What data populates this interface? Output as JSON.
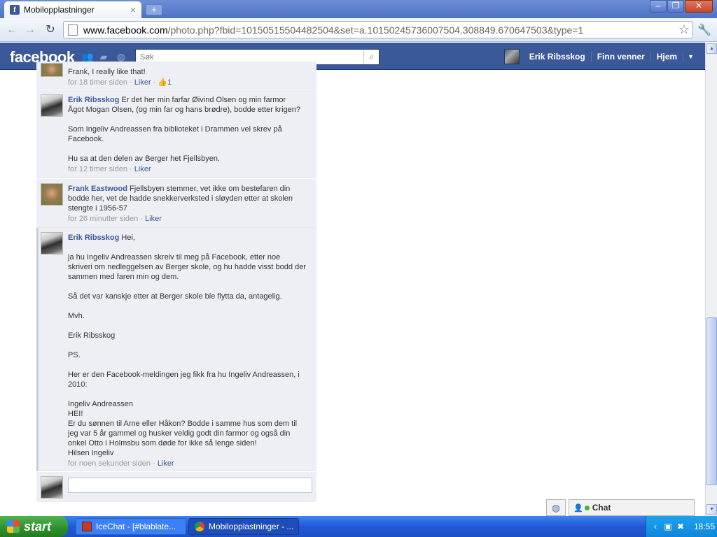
{
  "browser": {
    "tab_title": "Mobilopplastninger",
    "tab_close": "×",
    "new_tab": "+",
    "url_host": "www.facebook.com",
    "url_path": "/photo.php?fbid=10150515504482504&set=a.10150245736007504.308849.670647503&type=1"
  },
  "facebook": {
    "logo": "facebook",
    "search_placeholder": "Søk",
    "user_name": "Erik Ribsskog",
    "find_friends": "Finn venner",
    "home": "Hjem"
  },
  "comments": [
    {
      "author": "",
      "text": "Frank, I really like that!",
      "time": "for 18 timer siden",
      "like": "Liker",
      "like_count": "1"
    },
    {
      "author": "Erik Ribsskog",
      "text_first": "Er det her min farfar Øivind Olsen og min farmor",
      "text_rest": "Ågot Mogan Olsen, (og min far og hans brødre), bodde etter krigen?\n\nSom Ingeliv Andreassen fra biblioteket i Drammen vel skrev på Facebook.\n\nHu sa at den delen av Berger het Fjellsbyen.",
      "time": "for 12 timer siden",
      "like": "Liker"
    },
    {
      "author": "Frank Eastwood",
      "text_first": "Fjellsbyen stemmer, vet ikke om bestefaren din",
      "text_rest": "bodde her, vet de hadde snekkerverksted i sløyden etter at skolen stengte i 1956-57",
      "time": "for 26 minutter siden",
      "like": "Liker"
    },
    {
      "author": "Erik Ribsskog",
      "text_first": "Hei,",
      "text_rest": "\nja hu Ingeliv Andreassen skreiv til meg på Facebook, etter noe skriveri om nedleggelsen av Berger skole, og hu hadde visst bodd der sammen med faren min og dem.\n\nSå det var kanskje etter at Berger skole ble flytta da, antagelig.\n\nMvh.\n\nErik Ribsskog\n\nPS.\n\nHer er den Facebook-meldingen jeg fikk fra hu Ingeliv Andreassen, i 2010:\n\nIngeliv Andreassen\nHEI!\nEr du sønnen til Arne eller Håkon? Bodde i samme hus som dem til jeg var 5 år gammel og husker veldig godt din farmor og også din onkel Otto i Holmsbu som døde for ikke så lenge siden!\nHilsen Ingeliv",
      "time": "for noen sekunder siden",
      "like": "Liker"
    }
  ],
  "chat": {
    "label": "Chat"
  },
  "taskbar": {
    "start": "start",
    "items": [
      "IceChat - [#blablate...",
      "Mobilopplastninger - ..."
    ],
    "clock": "18:55"
  }
}
